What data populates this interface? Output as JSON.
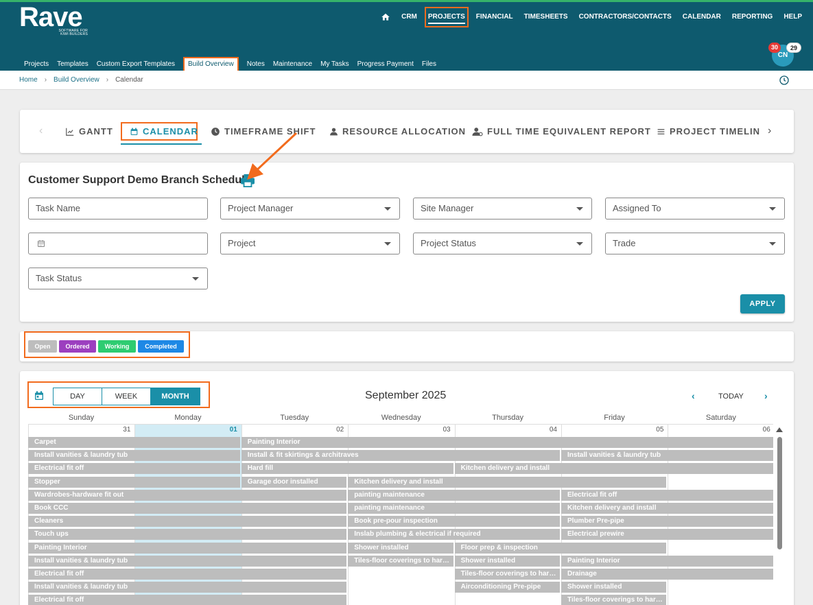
{
  "brand": {
    "name": "Rave",
    "tagline": "SOFTWARE FOR KIWI BUILDERS"
  },
  "topnav": [
    "CRM",
    "PROJECTS",
    "FINANCIAL",
    "TIMESHEETS",
    "CONTRACTORS/CONTACTS",
    "CALENDAR",
    "REPORTING",
    "HELP"
  ],
  "subnav": [
    "Projects",
    "Templates",
    "Custom Export Templates",
    "Build Overview",
    "Notes",
    "Maintenance",
    "My Tasks",
    "Progress Payment",
    "Files"
  ],
  "user": {
    "initials": "CN",
    "badge_red": "30",
    "badge_white": "29"
  },
  "breadcrumb": {
    "home": "Home",
    "parent": "Build Overview",
    "current": "Calendar"
  },
  "tabs": [
    "GANTT",
    "CALENDAR",
    "TIMEFRAME SHIFT",
    "RESOURCE ALLOCATION",
    "FULL TIME EQUIVALENT REPORT",
    "PROJECT TIMELIN"
  ],
  "schedule": {
    "title": "Customer Support Demo Branch Schedule"
  },
  "filters": {
    "task_name": "Task Name",
    "project_manager": "Project Manager",
    "site_manager": "Site Manager",
    "assigned_to": "Assigned To",
    "project": "Project",
    "project_status": "Project Status",
    "trade": "Trade",
    "task_status": "Task Status",
    "apply": "APPLY"
  },
  "legend": [
    {
      "label": "Open",
      "color": "#bdbdbd"
    },
    {
      "label": "Ordered",
      "color": "#9c3fbf"
    },
    {
      "label": "Working",
      "color": "#2ecc71"
    },
    {
      "label": "Completed",
      "color": "#1e88e5"
    }
  ],
  "calendar": {
    "views": [
      "DAY",
      "WEEK",
      "MONTH"
    ],
    "active_view": "MONTH",
    "month_title": "September 2025",
    "today_label": "TODAY",
    "weekdays": [
      "Sunday",
      "Monday",
      "Tuesday",
      "Wednesday",
      "Thursday",
      "Friday",
      "Saturday"
    ],
    "day_numbers": [
      "31",
      "01",
      "02",
      "03",
      "04",
      "05",
      "06"
    ],
    "event_color": "#bdbdbd",
    "events": [
      {
        "label": "Carpet",
        "start": 0,
        "span": 2,
        "row": 0
      },
      {
        "label": "Painting Interior",
        "start": 2,
        "span": 5,
        "row": 0
      },
      {
        "label": "Install vanities & laundry tub",
        "start": 0,
        "span": 2,
        "row": 1
      },
      {
        "label": "Install & fit skirtings & architraves",
        "start": 2,
        "span": 3,
        "row": 1
      },
      {
        "label": "Install vanities & laundry tub",
        "start": 5,
        "span": 2,
        "row": 1
      },
      {
        "label": "Electrical fit off",
        "start": 0,
        "span": 2,
        "row": 2
      },
      {
        "label": "Hard fill",
        "start": 2,
        "span": 2,
        "row": 2
      },
      {
        "label": "Kitchen delivery and install",
        "start": 4,
        "span": 3,
        "row": 2
      },
      {
        "label": "Stopper",
        "start": 0,
        "span": 2,
        "row": 3
      },
      {
        "label": "Garage door installed",
        "start": 2,
        "span": 1,
        "row": 3
      },
      {
        "label": "Kitchen delivery and install",
        "start": 3,
        "span": 3,
        "row": 3
      },
      {
        "label": "Wardrobes-hardware fit out",
        "start": 0,
        "span": 3,
        "row": 4
      },
      {
        "label": "painting maintenance",
        "start": 3,
        "span": 2,
        "row": 4
      },
      {
        "label": "Electrical fit off",
        "start": 5,
        "span": 2,
        "row": 4
      },
      {
        "label": "Book CCC",
        "start": 0,
        "span": 3,
        "row": 5
      },
      {
        "label": "painting maintenance",
        "start": 3,
        "span": 2,
        "row": 5
      },
      {
        "label": "Kitchen delivery and install",
        "start": 5,
        "span": 2,
        "row": 5
      },
      {
        "label": "Cleaners",
        "start": 0,
        "span": 3,
        "row": 6
      },
      {
        "label": "Book pre-pour inspection",
        "start": 3,
        "span": 2,
        "row": 6
      },
      {
        "label": "Plumber Pre-pipe",
        "start": 5,
        "span": 2,
        "row": 6
      },
      {
        "label": "Touch ups",
        "start": 0,
        "span": 3,
        "row": 7
      },
      {
        "label": "Inslab plumbing & electrical if required",
        "start": 3,
        "span": 2,
        "row": 7
      },
      {
        "label": "Electrical prewire",
        "start": 5,
        "span": 2,
        "row": 7
      },
      {
        "label": "Painting Interior",
        "start": 0,
        "span": 3,
        "row": 8
      },
      {
        "label": "Shower installed",
        "start": 3,
        "span": 1,
        "row": 8
      },
      {
        "label": "Floor prep & inspection",
        "start": 4,
        "span": 2,
        "row": 8
      },
      {
        "label": "Install vanities & laundry tub",
        "start": 0,
        "span": 3,
        "row": 9
      },
      {
        "label": "Tiles-floor coverings to hard surfaces",
        "start": 3,
        "span": 1,
        "row": 9
      },
      {
        "label": "Shower installed",
        "start": 4,
        "span": 1,
        "row": 9
      },
      {
        "label": "Painting Interior",
        "start": 5,
        "span": 2,
        "row": 9
      },
      {
        "label": "Electrical fit off",
        "start": 0,
        "span": 3,
        "row": 10
      },
      {
        "label": "Tiles-floor coverings to hard surfaces",
        "start": 4,
        "span": 1,
        "row": 10
      },
      {
        "label": "Drainage",
        "start": 5,
        "span": 2,
        "row": 10
      },
      {
        "label": "Install vanities & laundry tub",
        "start": 0,
        "span": 3,
        "row": 11
      },
      {
        "label": "Airconditioning Pre-pipe",
        "start": 4,
        "span": 1,
        "row": 11
      },
      {
        "label": "Shower installed",
        "start": 5,
        "span": 1,
        "row": 11
      },
      {
        "label": "Electrical fit off",
        "start": 0,
        "span": 3,
        "row": 12
      },
      {
        "label": "Tiles-floor coverings to hard surfaces",
        "start": 5,
        "span": 1,
        "row": 12
      }
    ]
  }
}
